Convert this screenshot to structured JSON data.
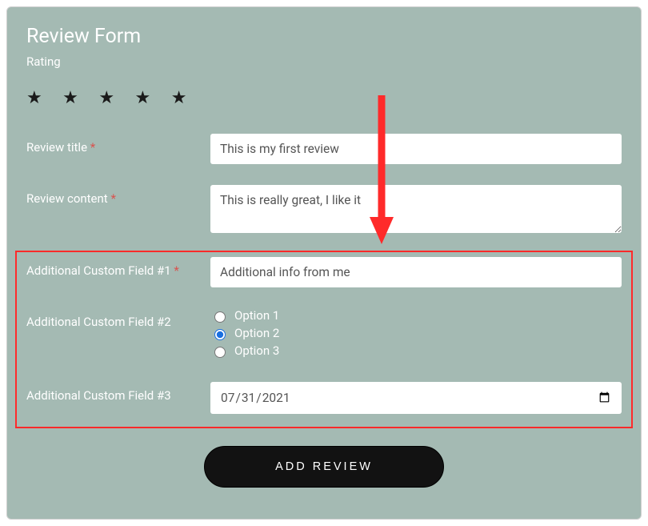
{
  "form": {
    "title": "Review Form",
    "rating_label": "Rating",
    "stars": "★ ★ ★ ★ ★",
    "rating_value": 5
  },
  "fields": {
    "title": {
      "label": "Review title",
      "required_marker": "*",
      "value": "This is my first review"
    },
    "content": {
      "label": "Review content",
      "required_marker": "*",
      "value": "This is really great, I like it"
    },
    "custom1": {
      "label": "Additional Custom Field #1",
      "required_marker": "*",
      "value": "Additional info from me"
    },
    "custom2": {
      "label": "Additional Custom Field #2",
      "options": [
        "Option 1",
        "Option 2",
        "Option 3"
      ],
      "selected_index": 1
    },
    "custom3": {
      "label": "Additional Custom Field #3",
      "value": "2021-07-31",
      "display": "07/31/2021"
    }
  },
  "button": {
    "label": "ADD REVIEW"
  },
  "annotation": {
    "arrow_color": "#ff2a2a",
    "highlight_color": "#ff2a2a"
  }
}
